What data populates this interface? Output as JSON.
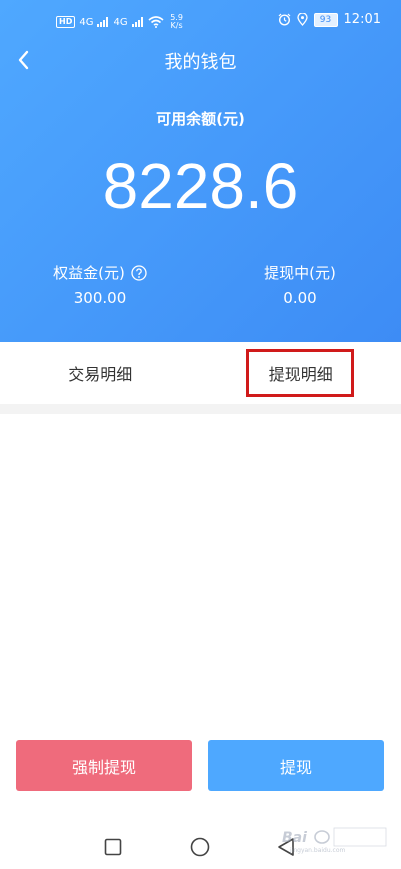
{
  "status_bar": {
    "network_badge": "HD",
    "signal_1": "4G",
    "signal_2": "4G",
    "speed_value": "5.9",
    "speed_unit": "K/s",
    "battery": "93",
    "time": "12:01"
  },
  "nav": {
    "title": "我的钱包"
  },
  "balance": {
    "label": "可用余额(元)",
    "value": "8228.6"
  },
  "sub": {
    "left_label": "权益金(元)",
    "left_value": "300.00",
    "right_label": "提现中(元)",
    "right_value": "0.00"
  },
  "tabs": {
    "items": [
      {
        "label": "交易明细"
      },
      {
        "label": "提现明细"
      }
    ]
  },
  "buttons": {
    "force_withdraw": "强制提现",
    "withdraw": "提现"
  },
  "colors": {
    "header_blue": "#4a9cff",
    "force_button": "#ef6b7c",
    "withdraw_button": "#4ea8ff",
    "highlight_red": "#d01a1a"
  }
}
